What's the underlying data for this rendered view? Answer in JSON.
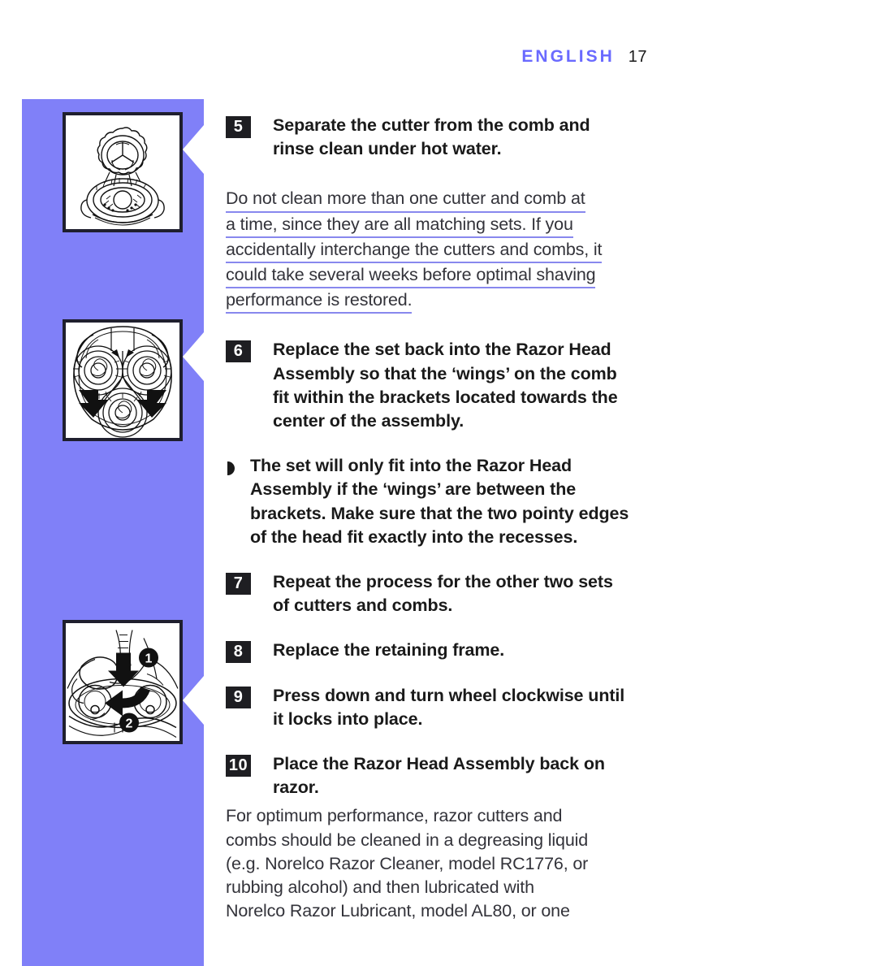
{
  "header": {
    "language": "ENGLISH",
    "page_number": "17"
  },
  "colors": {
    "accent_purple": "#8080f8",
    "header_purple": "#6a6aff",
    "underline_purple": "#8888ee",
    "badge_dark": "#1e1e22",
    "text_dark": "#1a1a1a"
  },
  "figures": [
    {
      "name": "cutter-and-comb-separated",
      "caption_step": "5"
    },
    {
      "name": "razor-head-assembly-three-sets",
      "caption_step": "6"
    },
    {
      "name": "press-down-and-turn-wheel",
      "caption_step": "9",
      "markers": [
        "1",
        "2"
      ]
    }
  ],
  "steps": [
    {
      "number": "5",
      "lines": [
        "Separate the cutter from the comb and",
        "rinse clean under hot water."
      ]
    },
    {
      "number": "6",
      "lines": [
        "Replace the set back into the Razor Head",
        "Assembly so that the ‘wings’ on the comb",
        "fit within the brackets located towards the",
        "center of the assembly."
      ]
    },
    {
      "number": "7",
      "lines": [
        "Repeat the process for the other two sets",
        "of cutters and combs."
      ]
    },
    {
      "number": "8",
      "lines": [
        "Replace the retaining frame."
      ]
    },
    {
      "number": "9",
      "lines": [
        "Press down and turn wheel clockwise until",
        "it locks into place."
      ]
    },
    {
      "number": "10",
      "lines": [
        "Place the Razor Head Assembly back on",
        "razor."
      ]
    }
  ],
  "note": {
    "bullet": "arrow-bullet",
    "lines": [
      "The set will only fit into the Razor Head",
      "Assembly if the ‘wings’ are between the",
      "brackets. Make sure that the two pointy edges",
      "of the head fit exactly into the recesses."
    ]
  },
  "warning_paragraph": {
    "underlined": true,
    "lines": [
      "Do not clean more than one cutter and comb at",
      "a time, since they are all matching sets. If you",
      "accidentally interchange the cutters and combs, it",
      "could take several weeks before optimal shaving",
      "performance is restored."
    ]
  },
  "closing_paragraph": {
    "underlined": false,
    "lines": [
      "For optimum performance, razor cutters and",
      "combs should be cleaned in a degreasing liquid",
      "(e.g. Norelco Razor Cleaner, model RC1776, or",
      "rubbing alcohol) and then lubricated with",
      "Norelco Razor Lubricant, model AL80, or one"
    ]
  }
}
